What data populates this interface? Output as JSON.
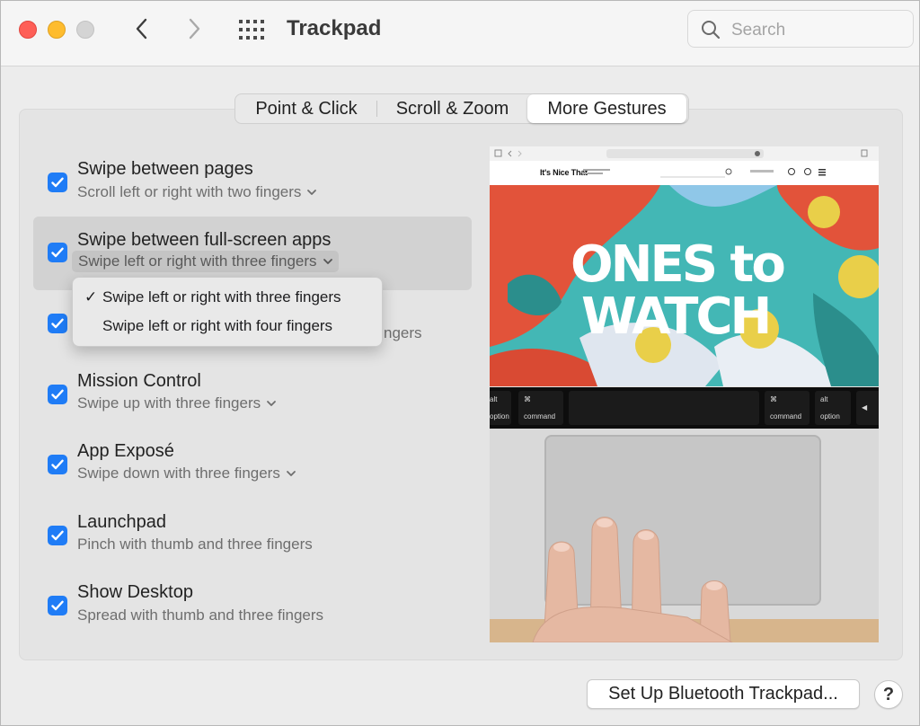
{
  "window": {
    "title": "Trackpad"
  },
  "search": {
    "placeholder": "Search",
    "value": ""
  },
  "tabs": [
    {
      "label": "Point & Click",
      "selected": false
    },
    {
      "label": "Scroll & Zoom",
      "selected": false
    },
    {
      "label": "More Gestures",
      "selected": true
    }
  ],
  "gestures": [
    {
      "title": "Swipe between pages",
      "subtitle": "Scroll left or right with two fingers",
      "checked": true,
      "has_menu": true
    },
    {
      "title": "Swipe between full-screen apps",
      "subtitle": "Swipe left or right with three fingers",
      "checked": true,
      "has_menu": true
    },
    {
      "title": "",
      "subtitle": "ngers",
      "checked": true,
      "has_menu": true
    },
    {
      "title": "Mission Control",
      "subtitle": "Swipe up with three fingers",
      "checked": true,
      "has_menu": true
    },
    {
      "title": "App Exposé",
      "subtitle": "Swipe down with three fingers",
      "checked": true,
      "has_menu": true
    },
    {
      "title": "Launchpad",
      "subtitle": "Pinch with thumb and three fingers",
      "checked": true,
      "has_menu": false
    },
    {
      "title": "Show Desktop",
      "subtitle": "Spread with thumb and three fingers",
      "checked": true,
      "has_menu": false
    }
  ],
  "dropdown": {
    "items": [
      {
        "label": "Swipe left or right with three fingers",
        "checked": true,
        "mark": "✓"
      },
      {
        "label": "Swipe left or right with four fingers",
        "checked": false,
        "mark": ""
      }
    ]
  },
  "preview": {
    "site_name": "It's Nice That",
    "headline_line1": "ONES to",
    "headline_line2": "WATCH",
    "keys": [
      {
        "top": "alt",
        "bottom": "option"
      },
      {
        "top": "⌘",
        "bottom": "command"
      },
      {
        "top": "⌘",
        "bottom": "command"
      },
      {
        "top": "alt",
        "bottom": "option"
      }
    ]
  },
  "footer": {
    "bluetooth_label": "Set Up Bluetooth Trackpad...",
    "help_label": "?"
  },
  "colors": {
    "accent": "#1f7cf6",
    "hero_red": "#e2533a",
    "hero_teal": "#43b7b5",
    "hero_yellow": "#e9cf49"
  }
}
